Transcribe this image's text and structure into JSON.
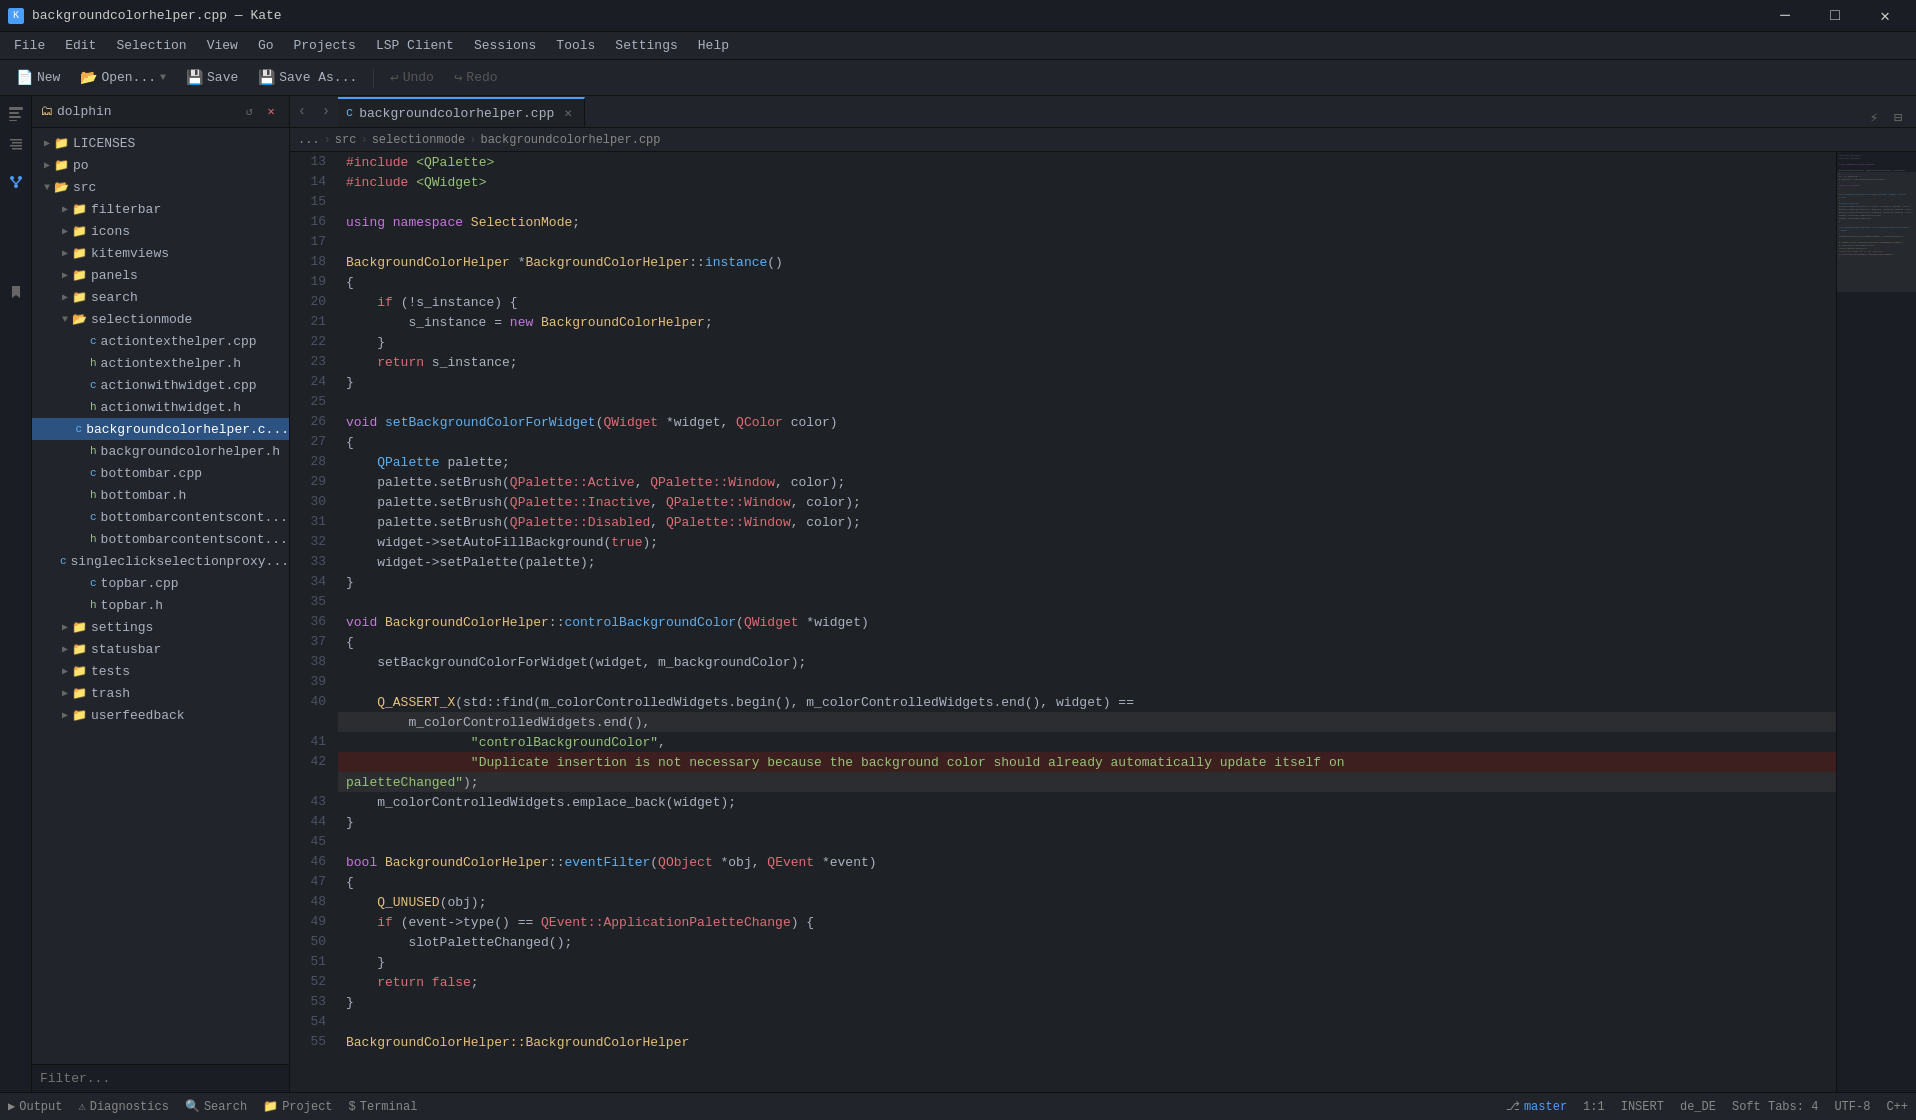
{
  "titlebar": {
    "title": "backgroundcolorhelper.cpp — Kate",
    "icon": "K",
    "minimize": "─",
    "maximize": "□",
    "close": "✕"
  },
  "menubar": {
    "items": [
      "File",
      "Edit",
      "Selection",
      "View",
      "Go",
      "Projects",
      "LSP Client",
      "Sessions",
      "Tools",
      "Settings",
      "Help"
    ]
  },
  "toolbar": {
    "new_label": "New",
    "open_label": "Open...",
    "save_label": "Save",
    "save_as_label": "Save As...",
    "undo_label": "Undo",
    "redo_label": "Redo"
  },
  "file_panel": {
    "title": "dolphin",
    "filter_placeholder": "Filter...",
    "tree": [
      {
        "level": 0,
        "type": "folder",
        "name": "LICENSES",
        "expanded": false
      },
      {
        "level": 0,
        "type": "folder",
        "name": "po",
        "expanded": false
      },
      {
        "level": 0,
        "type": "folder",
        "name": "src",
        "expanded": true
      },
      {
        "level": 1,
        "type": "folder",
        "name": "filterbar",
        "expanded": false
      },
      {
        "level": 1,
        "type": "folder",
        "name": "icons",
        "expanded": false
      },
      {
        "level": 1,
        "type": "folder",
        "name": "kitemviews",
        "expanded": false
      },
      {
        "level": 1,
        "type": "folder",
        "name": "panels",
        "expanded": false
      },
      {
        "level": 1,
        "type": "folder",
        "name": "search",
        "expanded": false
      },
      {
        "level": 1,
        "type": "folder",
        "name": "selectionmode",
        "expanded": true
      },
      {
        "level": 2,
        "type": "cpp",
        "name": "actiontexthelper.cpp"
      },
      {
        "level": 2,
        "type": "h",
        "name": "actiontexthelper.h"
      },
      {
        "level": 2,
        "type": "cpp",
        "name": "actionwithwidget.cpp"
      },
      {
        "level": 2,
        "type": "h",
        "name": "actionwithwidget.h"
      },
      {
        "level": 2,
        "type": "cpp",
        "name": "backgroundcolorhelper.c...",
        "selected": true
      },
      {
        "level": 2,
        "type": "h",
        "name": "backgroundcolorhelper.h"
      },
      {
        "level": 2,
        "type": "cpp",
        "name": "bottombar.cpp"
      },
      {
        "level": 2,
        "type": "h",
        "name": "bottombar.h"
      },
      {
        "level": 2,
        "type": "cpp",
        "name": "bottombarcontentscont..."
      },
      {
        "level": 2,
        "type": "h",
        "name": "bottombarcontentscont..."
      },
      {
        "level": 2,
        "type": "cpp",
        "name": "singleclickselectionproxy..."
      },
      {
        "level": 2,
        "type": "cpp",
        "name": "topbar.cpp"
      },
      {
        "level": 2,
        "type": "h",
        "name": "topbar.h"
      },
      {
        "level": 1,
        "type": "folder",
        "name": "settings",
        "expanded": false
      },
      {
        "level": 1,
        "type": "folder",
        "name": "statusbar",
        "expanded": false
      },
      {
        "level": 1,
        "type": "folder",
        "name": "tests",
        "expanded": false
      },
      {
        "level": 1,
        "type": "folder",
        "name": "trash",
        "expanded": false
      },
      {
        "level": 1,
        "type": "folder",
        "name": "userfeedback",
        "expanded": false
      }
    ]
  },
  "editor": {
    "filename": "backgroundcolorhelper.cpp",
    "breadcrumb": [
      "...",
      "src",
      "selectionmode",
      "backgroundcolorhelper.cpp"
    ],
    "lines": [
      {
        "n": 13,
        "tokens": [
          {
            "t": "#include ",
            "c": "pp"
          },
          {
            "t": "<QPalette>",
            "c": "inc"
          }
        ]
      },
      {
        "n": 14,
        "tokens": [
          {
            "t": "#include ",
            "c": "pp"
          },
          {
            "t": "<QWidget>",
            "c": "inc"
          }
        ]
      },
      {
        "n": 15,
        "tokens": []
      },
      {
        "n": 16,
        "tokens": [
          {
            "t": "using ",
            "c": "kw"
          },
          {
            "t": "namespace ",
            "c": "kw"
          },
          {
            "t": "SelectionMode",
            "c": "ns"
          },
          {
            "t": ";",
            "c": "op"
          }
        ]
      },
      {
        "n": 17,
        "tokens": []
      },
      {
        "n": 18,
        "tokens": [
          {
            "t": "BackgroundColorHelper ",
            "c": "ns"
          },
          {
            "t": "*",
            "c": "op"
          },
          {
            "t": "BackgroundColorHelper",
            "c": "ns"
          },
          {
            "t": "::",
            "c": "op"
          },
          {
            "t": "instance",
            "c": "fn"
          },
          {
            "t": "()",
            "c": "op"
          }
        ]
      },
      {
        "n": 19,
        "tokens": [
          {
            "t": "{",
            "c": "op"
          }
        ]
      },
      {
        "n": 20,
        "tokens": [
          {
            "t": "    ",
            "c": ""
          },
          {
            "t": "if",
            "c": "kw2"
          },
          {
            "t": " (!s_instance) {",
            "c": ""
          }
        ]
      },
      {
        "n": 21,
        "tokens": [
          {
            "t": "        s_instance = ",
            "c": ""
          },
          {
            "t": "new",
            "c": "kw"
          },
          {
            "t": " ",
            "c": ""
          },
          {
            "t": "BackgroundColorHelper",
            "c": "ns"
          },
          {
            "t": ";",
            "c": ""
          }
        ]
      },
      {
        "n": 22,
        "tokens": [
          {
            "t": "    }",
            "c": ""
          }
        ]
      },
      {
        "n": 23,
        "tokens": [
          {
            "t": "    ",
            "c": ""
          },
          {
            "t": "return",
            "c": "kw2"
          },
          {
            "t": " s_instance;",
            "c": ""
          }
        ]
      },
      {
        "n": 24,
        "tokens": [
          {
            "t": "}",
            "c": ""
          }
        ]
      },
      {
        "n": 25,
        "tokens": []
      },
      {
        "n": 26,
        "tokens": [
          {
            "t": "void",
            "c": "kw"
          },
          {
            "t": " ",
            "c": ""
          },
          {
            "t": "setBackgroundColorForWidget",
            "c": "fn"
          },
          {
            "t": "(",
            "c": ""
          },
          {
            "t": "QWidget",
            "c": "param"
          },
          {
            "t": " *widget, ",
            "c": ""
          },
          {
            "t": "QColor",
            "c": "param"
          },
          {
            "t": " color)",
            "c": ""
          }
        ]
      },
      {
        "n": 27,
        "tokens": [
          {
            "t": "{",
            "c": ""
          }
        ]
      },
      {
        "n": 28,
        "tokens": [
          {
            "t": "    ",
            "c": ""
          },
          {
            "t": "QPalette",
            "c": "type"
          },
          {
            "t": " palette;",
            "c": ""
          }
        ]
      },
      {
        "n": 29,
        "tokens": [
          {
            "t": "    palette.setBrush(",
            "c": ""
          },
          {
            "t": "QPalette::Active",
            "c": "param"
          },
          {
            "t": ", ",
            "c": ""
          },
          {
            "t": "QPalette::Window",
            "c": "param"
          },
          {
            "t": ", color);",
            "c": ""
          }
        ]
      },
      {
        "n": 30,
        "tokens": [
          {
            "t": "    palette.setBrush(",
            "c": ""
          },
          {
            "t": "QPalette::Inactive",
            "c": "param"
          },
          {
            "t": ", ",
            "c": ""
          },
          {
            "t": "QPalette::Window",
            "c": "param"
          },
          {
            "t": ", color);",
            "c": ""
          }
        ]
      },
      {
        "n": 31,
        "tokens": [
          {
            "t": "    palette.setBrush(",
            "c": ""
          },
          {
            "t": "QPalette::Disabled",
            "c": "param"
          },
          {
            "t": ", ",
            "c": ""
          },
          {
            "t": "QPalette::Window",
            "c": "param"
          },
          {
            "t": ", color);",
            "c": ""
          }
        ]
      },
      {
        "n": 32,
        "tokens": [
          {
            "t": "    widget->setAutoFillBackground(",
            "c": ""
          },
          {
            "t": "true",
            "c": "kw2"
          },
          {
            "t": ");",
            "c": ""
          }
        ]
      },
      {
        "n": 33,
        "tokens": [
          {
            "t": "    widget->setPalette(palette);",
            "c": ""
          }
        ]
      },
      {
        "n": 34,
        "tokens": [
          {
            "t": "}",
            "c": ""
          }
        ]
      },
      {
        "n": 35,
        "tokens": []
      },
      {
        "n": 36,
        "tokens": [
          {
            "t": "void",
            "c": "kw"
          },
          {
            "t": " ",
            "c": ""
          },
          {
            "t": "BackgroundColorHelper",
            "c": "ns"
          },
          {
            "t": "::",
            "c": ""
          },
          {
            "t": "controlBackgroundColor",
            "c": "fn"
          },
          {
            "t": "(",
            "c": ""
          },
          {
            "t": "QWidget",
            "c": "param"
          },
          {
            "t": " *widget)",
            "c": ""
          }
        ]
      },
      {
        "n": 37,
        "tokens": [
          {
            "t": "{",
            "c": ""
          }
        ]
      },
      {
        "n": 38,
        "tokens": [
          {
            "t": "    setBackgroundColorForWidget(widget, m_backgroundColor);",
            "c": ""
          }
        ]
      },
      {
        "n": 39,
        "tokens": []
      },
      {
        "n": 40,
        "tokens": [
          {
            "t": "    ",
            "c": ""
          },
          {
            "t": "Q_ASSERT_X",
            "c": "macro"
          },
          {
            "t": "(std::find(m_colorControlledWidgets.begin(), m_colorControlledWidgets.end(), widget) ==",
            "c": ""
          }
        ]
      },
      {
        "n": "40b",
        "tokens": [
          {
            "t": "        m_colorControlledWidgets.end(),",
            "c": ""
          }
        ],
        "highlighted": true
      },
      {
        "n": 41,
        "tokens": [
          {
            "t": "                ",
            "c": ""
          },
          {
            "t": "\"controlBackgroundColor\"",
            "c": "str"
          },
          {
            "t": ",",
            "c": ""
          }
        ]
      },
      {
        "n": 42,
        "tokens": [
          {
            "t": "                ",
            "c": ""
          },
          {
            "t": "\"Duplicate insertion is not necessary because the background color should already automatically update itself on",
            "c": "str"
          }
        ],
        "error": true
      },
      {
        "n": "42b",
        "tokens": [
          {
            "t": "paletteChanged\"",
            "c": "str"
          },
          {
            "t": ");",
            "c": ""
          }
        ],
        "highlighted": true
      },
      {
        "n": 43,
        "tokens": [
          {
            "t": "    m_colorControlledWidgets.emplace_back(widget);",
            "c": ""
          }
        ]
      },
      {
        "n": 44,
        "tokens": [
          {
            "t": "}",
            "c": ""
          }
        ]
      },
      {
        "n": 45,
        "tokens": []
      },
      {
        "n": 46,
        "tokens": [
          {
            "t": "bool",
            "c": "kw"
          },
          {
            "t": " ",
            "c": ""
          },
          {
            "t": "BackgroundColorHelper",
            "c": "ns"
          },
          {
            "t": "::",
            "c": ""
          },
          {
            "t": "eventFilter",
            "c": "fn"
          },
          {
            "t": "(",
            "c": ""
          },
          {
            "t": "QObject",
            "c": "param"
          },
          {
            "t": " *obj, ",
            "c": ""
          },
          {
            "t": "QEvent",
            "c": "param"
          },
          {
            "t": " *event)",
            "c": ""
          }
        ]
      },
      {
        "n": 47,
        "tokens": [
          {
            "t": "{",
            "c": ""
          }
        ]
      },
      {
        "n": 48,
        "tokens": [
          {
            "t": "    ",
            "c": ""
          },
          {
            "t": "Q_UNUSED",
            "c": "macro"
          },
          {
            "t": "(obj);",
            "c": ""
          }
        ]
      },
      {
        "n": 49,
        "tokens": [
          {
            "t": "    ",
            "c": ""
          },
          {
            "t": "if",
            "c": "kw2"
          },
          {
            "t": " (event->type() == ",
            "c": ""
          },
          {
            "t": "QEvent::ApplicationPaletteChange",
            "c": "param"
          },
          {
            "t": ") {",
            "c": ""
          }
        ]
      },
      {
        "n": 50,
        "tokens": [
          {
            "t": "        slotPaletteChanged();",
            "c": ""
          }
        ]
      },
      {
        "n": 51,
        "tokens": [
          {
            "t": "    }",
            "c": ""
          }
        ]
      },
      {
        "n": 52,
        "tokens": [
          {
            "t": "    ",
            "c": ""
          },
          {
            "t": "return",
            "c": "kw2"
          },
          {
            "t": " ",
            "c": ""
          },
          {
            "t": "false",
            "c": "kw2"
          },
          {
            "t": ";",
            "c": ""
          }
        ]
      },
      {
        "n": 53,
        "tokens": [
          {
            "t": "}",
            "c": ""
          }
        ]
      },
      {
        "n": 54,
        "tokens": []
      },
      {
        "n": 55,
        "tokens": [
          {
            "t": "BackgroundColorHelper::BackgroundColorHelper",
            "c": "ns"
          }
        ]
      }
    ]
  },
  "statusbar": {
    "output": "Output",
    "diagnostics": "Diagnostics",
    "search": "Search",
    "project": "Project",
    "terminal": "Terminal",
    "branch": "master",
    "position": "1:1",
    "mode": "INSERT",
    "locale": "de_DE",
    "indent": "Soft Tabs: 4",
    "encoding": "UTF-8",
    "type": "C++"
  }
}
